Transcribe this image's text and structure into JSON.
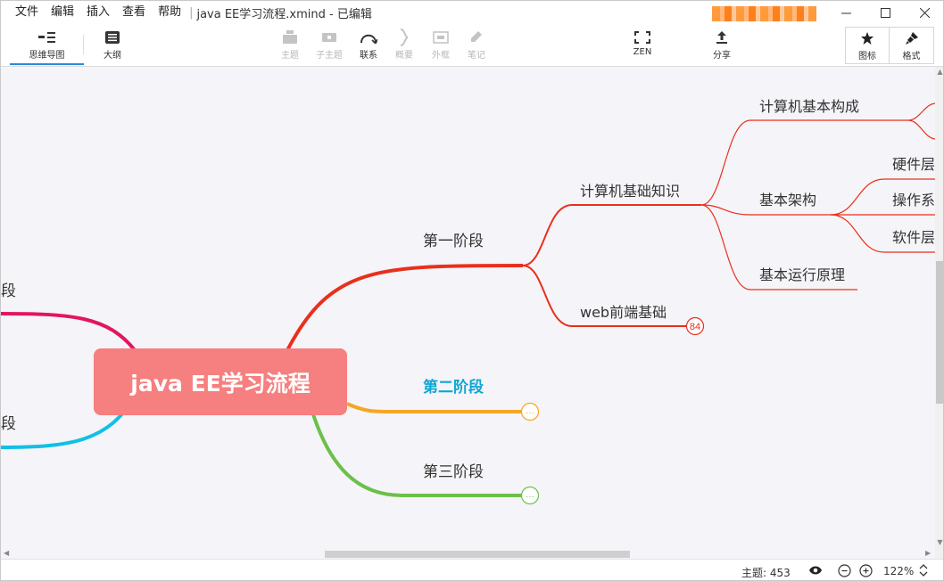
{
  "menu": [
    "文件",
    "编辑",
    "插入",
    "查看",
    "帮助"
  ],
  "window": {
    "title": "java EE学习流程.xmind - 已编辑",
    "separator": "|"
  },
  "toolbar": {
    "mindmap": "思维导图",
    "outline": "大纲",
    "topic": "主题",
    "subtopic": "子主题",
    "relationship": "联系",
    "summary": "概要",
    "boundary": "外框",
    "notes": "笔记",
    "zen": "ZEN",
    "share": "分享",
    "icons": "图标",
    "format": "格式"
  },
  "mindmap": {
    "root": "java EE学习流程",
    "left_branches": [
      "段",
      "段"
    ],
    "branches": [
      "第一阶段",
      "第二阶段",
      "第三阶段"
    ],
    "stage1_children": [
      "计算机基础知识",
      "web前端基础"
    ],
    "web_count": "84",
    "collapsed_marker": "···",
    "basics_children": [
      "计算机基本构成",
      "基本架构",
      "基本运行原理"
    ],
    "architecture_children": [
      "硬件层",
      "操作系",
      "软件层"
    ],
    "colors": {
      "root_fill": "#f67f7f",
      "stage1": "#e8301c",
      "stage2": "#f5a623",
      "stage3": "#6cc04a",
      "left_top": "#e2155f",
      "left_bottom": "#10c0e6",
      "stage2_text": "#0fa6d4"
    }
  },
  "status": {
    "topics": "主题: 453",
    "zoom": "122%"
  }
}
